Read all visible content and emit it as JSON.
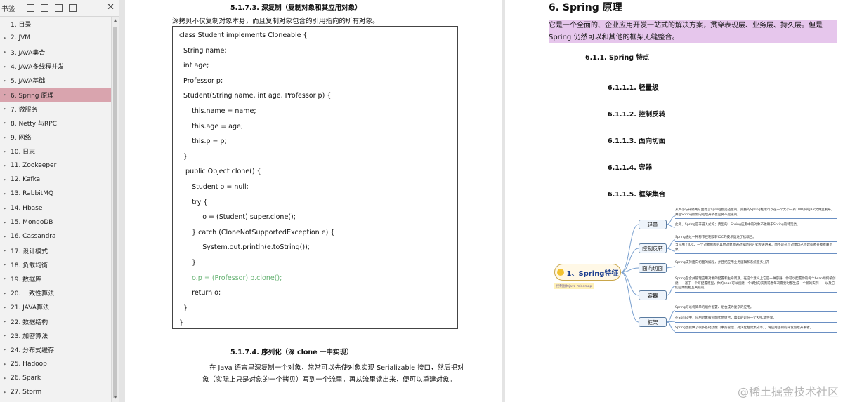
{
  "sidebar": {
    "header_label": "书签",
    "items": [
      {
        "label": "1. 目录",
        "arrow": ""
      },
      {
        "label": "2. JVM",
        "arrow": "▸"
      },
      {
        "label": "3. JAVA集合",
        "arrow": "▸"
      },
      {
        "label": "4. JAVA多线程并发",
        "arrow": "▸"
      },
      {
        "label": "5. JAVA基础",
        "arrow": "▸"
      },
      {
        "label": "6. Spring 原理",
        "arrow": "▸",
        "active": true
      },
      {
        "label": "7.    微服务",
        "arrow": "▸"
      },
      {
        "label": "8. Netty 与RPC",
        "arrow": "▸"
      },
      {
        "label": "9. 网络",
        "arrow": "▸"
      },
      {
        "label": "10. 日志",
        "arrow": "▸"
      },
      {
        "label": "11. Zookeeper",
        "arrow": "▸"
      },
      {
        "label": "12. Kafka",
        "arrow": "▸"
      },
      {
        "label": "13. RabbitMQ",
        "arrow": "▸"
      },
      {
        "label": "14. Hbase",
        "arrow": "▸"
      },
      {
        "label": "15. MongoDB",
        "arrow": "▸"
      },
      {
        "label": "16. Cassandra",
        "arrow": "▸"
      },
      {
        "label": "17. 设计模式",
        "arrow": "▸"
      },
      {
        "label": "18. 负载均衡",
        "arrow": "▸"
      },
      {
        "label": "19. 数据库",
        "arrow": "▸"
      },
      {
        "label": "20. 一致性算法",
        "arrow": "▸"
      },
      {
        "label": "21. JAVA算法",
        "arrow": "▸"
      },
      {
        "label": "22. 数据结构",
        "arrow": "▸"
      },
      {
        "label": "23. 加密算法",
        "arrow": "▸"
      },
      {
        "label": "24. 分布式缓存",
        "arrow": "▸"
      },
      {
        "label": "25. Hadoop",
        "arrow": "▸"
      },
      {
        "label": "26. Spark",
        "arrow": "▸"
      },
      {
        "label": "27. Storm",
        "arrow": "▸"
      }
    ]
  },
  "left_page": {
    "section_1": "5.1.7.3.      深复制（复制对象和其应用对象）",
    "intro": "深拷贝不仅复制对象本身，而且复制对象包含的引用指向的所有对象。",
    "code": [
      "class Student implements Cloneable {",
      "  String name;",
      "  int age;",
      "  Professor p;",
      "  Student(String name, int age, Professor p) {",
      "      this.name = name;",
      "      this.age = age;",
      "      this.p = p;",
      "  }",
      "   public Object clone() {",
      "      Student o = null;",
      "      try {",
      "           o = (Student) super.clone();",
      "      } catch (CloneNotSupportedException e) {",
      "           System.out.println(e.toString());",
      "      }",
      "      o.p = (Professor) p.clone();",
      "      return o;",
      "  }",
      "}"
    ],
    "section_2": "5.1.7.4.      序列化（深 clone 一中实现）",
    "para_1": "在 Java 语言里深复制一个对象，常常可以先使对象实现 Serializable 接口，然后把对",
    "para_2": "象（实际上只是对象的一个拷贝）写到一个流里，再从流里读出来，便可以重建对象。"
  },
  "right_page": {
    "title": "6. Spring 原理",
    "highlight": "它是一个全面的、企业应用开发一站式的解决方案，贯穿表现层、业务层、持久层。但是 Spring 仍然可以和其他的框架无缝整合。",
    "h_611": "6.1.1.  Spring 特点",
    "headings": [
      "6.1.1.1.    轻量级",
      "6.1.1.2.    控制反转",
      "6.1.1.3.    面向切面",
      "6.1.1.4.    容器",
      "6.1.1.5.    框架集合"
    ],
    "mindmap": {
      "root": "1、Spring特征",
      "root_note": "控制总体java-mindmap",
      "branches": [
        {
          "label": "轻量",
          "leaves": [
            "从大小与开销两方面而言Spring都是轻量的。完整的Spring框架可以在一个大小只有1MB多的JAR文件里发布，并且Spring所需的处理开销也是微不足道的。",
            "此外，Spring是非侵入式的；典型的，Spring应用中的对象不依赖于Spring的特定类。"
          ]
        },
        {
          "label": "控制反转",
          "leaves": [
            "Spring通过一种称作控制反转IOC的技术促进了松耦合。",
            "当应用了IOC，一个对象依赖的其他对象会通过被动的方式传递进来，而不是这个对象自己创建或者查找依赖对象。"
          ]
        },
        {
          "label": "面向切面",
          "leaves": [
            "Spring支持面向切面的编程，并且把应用业务逻辑和系统服务分开"
          ]
        },
        {
          "label": "容器",
          "leaves": [
            "Spring包含并管理应用对象的配置和生命周期，在这个意义上它是一种容器，你可以配置你的每个bean如何被创建——基于一个可配置原型，你的bean可以创建一个单独的实例或者每次需要时都生成一个新的实例——以及它们是如何相互关联的。"
          ]
        },
        {
          "label": "框架",
          "leaves": [
            "Spring可以将简单的组件配置、组合成为复杂的应用。",
            "在Spring中，应用对象被声明式地组合，典型的是在一个XML文件里。",
            "Spring也提供了很多基础功能（事务管理、持久化框架集成等），将应用逻辑的开发留给开发者。"
          ]
        }
      ]
    }
  },
  "watermark": "@稀土掘金技术社区"
}
